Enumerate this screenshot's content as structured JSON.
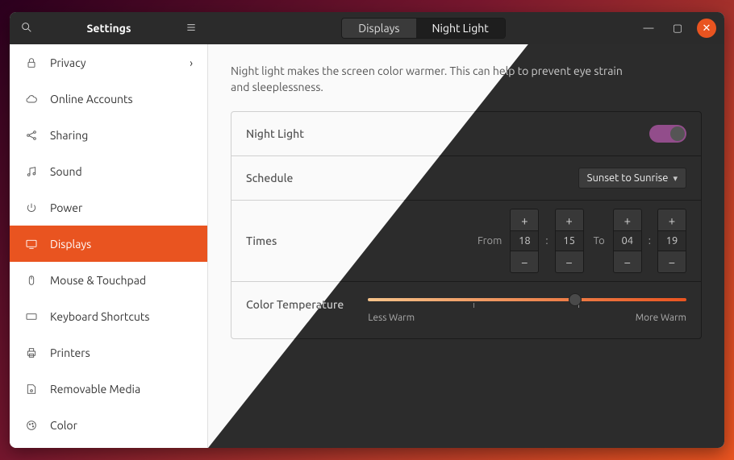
{
  "titlebar": {
    "title": "Settings",
    "tabs": {
      "displays": "Displays",
      "nightlight": "Night Light",
      "active": 1
    }
  },
  "sidebar": {
    "items": [
      {
        "id": "privacy",
        "label": "Privacy",
        "icon": "lock",
        "chevron": true
      },
      {
        "id": "accounts",
        "label": "Online Accounts",
        "icon": "cloud"
      },
      {
        "id": "sharing",
        "label": "Sharing",
        "icon": "share"
      },
      {
        "id": "sound",
        "label": "Sound",
        "icon": "music"
      },
      {
        "id": "power",
        "label": "Power",
        "icon": "power"
      },
      {
        "id": "displays",
        "label": "Displays",
        "icon": "monitor",
        "active": true
      },
      {
        "id": "mouse",
        "label": "Mouse & Touchpad",
        "icon": "mouse"
      },
      {
        "id": "keyboard",
        "label": "Keyboard Shortcuts",
        "icon": "keyboard"
      },
      {
        "id": "printers",
        "label": "Printers",
        "icon": "printer"
      },
      {
        "id": "removable",
        "label": "Removable Media",
        "icon": "disk"
      },
      {
        "id": "color",
        "label": "Color",
        "icon": "palette"
      }
    ]
  },
  "main": {
    "description": "Night light makes the screen color warmer. This can help to prevent eye strain and sleeplessness.",
    "rows": {
      "nightlight": {
        "label": "Night Light",
        "enabled": true
      },
      "schedule": {
        "label": "Schedule",
        "value": "Sunset to Sunrise"
      },
      "times": {
        "label": "Times",
        "from_label": "From",
        "to_label": "To",
        "from_h": "18",
        "from_m": "15",
        "to_h": "04",
        "to_m": "19"
      },
      "temperature": {
        "label": "Color Temperature",
        "less": "Less Warm",
        "more": "More Warm",
        "value": 0.65
      }
    }
  },
  "colors": {
    "accent": "#e95420",
    "switch_on": "#924d8b"
  }
}
